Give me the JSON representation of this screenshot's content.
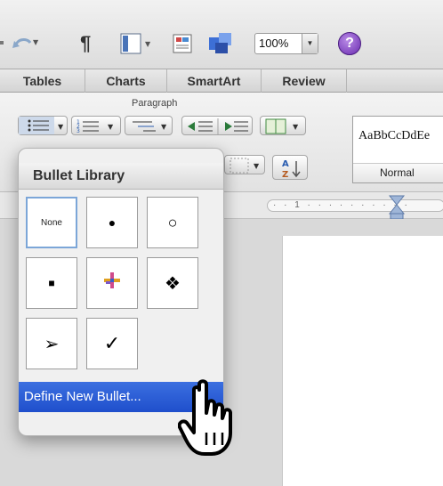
{
  "toolbar": {
    "pilcrow": "¶",
    "zoom_value": "100%",
    "help_label": "?"
  },
  "ribbon_tabs": [
    "Tables",
    "Charts",
    "SmartArt",
    "Review"
  ],
  "ribbon": {
    "group_label": "Paragraph",
    "style_sample": "AaBbCcDdEe",
    "style_name": "Normal",
    "ruler_marker": "1"
  },
  "bullet_library": {
    "title": "Bullet Library",
    "items": [
      {
        "label": "None",
        "glyph": ""
      },
      {
        "label": "",
        "glyph": "●"
      },
      {
        "label": "",
        "glyph": "○"
      },
      {
        "label": "",
        "glyph": "■"
      },
      {
        "label": "",
        "glyph": "✚"
      },
      {
        "label": "",
        "glyph": "❖"
      },
      {
        "label": "",
        "glyph": "➢"
      },
      {
        "label": "",
        "glyph": "✓"
      }
    ],
    "define_label": "Define New Bullet..."
  },
  "icons": {
    "hand_cursor": "pointing-hand-icon",
    "undo": "undo-icon",
    "view": "view-icon",
    "media": "media-browser-icon",
    "toolbox": "toolbox-icon"
  },
  "colors": {
    "selection": "#2356d4",
    "selected_border": "#7ca6d8",
    "help": "#7a3cc0"
  }
}
